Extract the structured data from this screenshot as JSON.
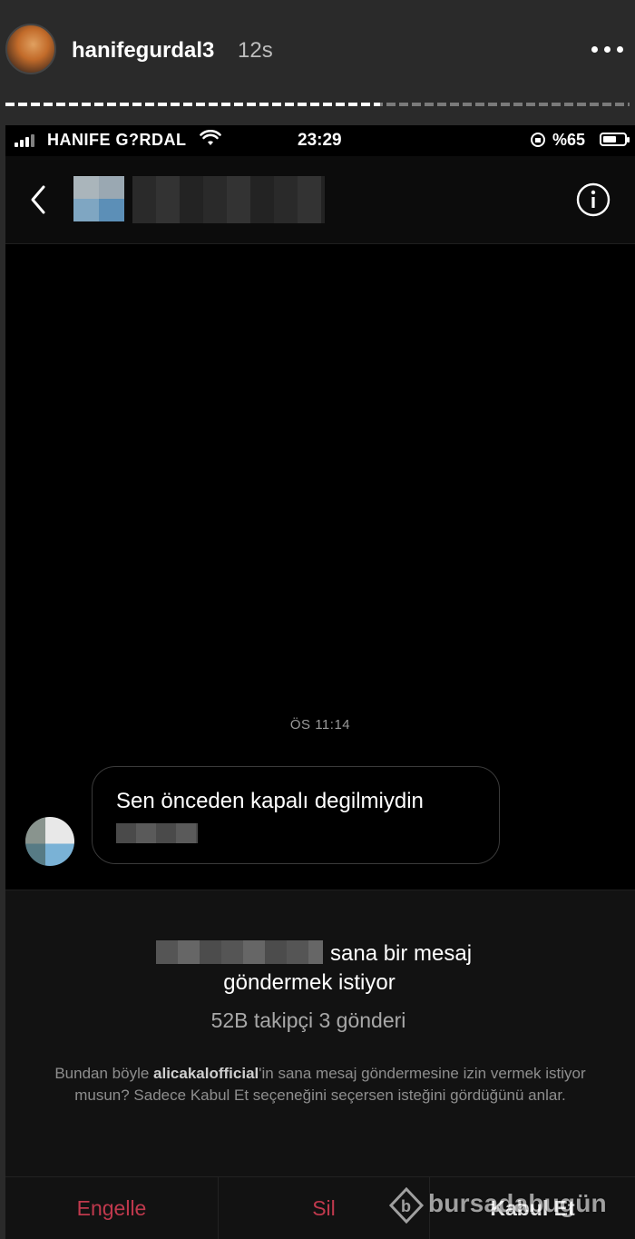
{
  "story": {
    "username": "hanifegurdal3",
    "time_ago": "12s",
    "progress_fraction": 0.6,
    "menu_icon": "more-horizontal-icon"
  },
  "status_bar": {
    "carrier": "HANIFE G?RDAL",
    "time": "23:29",
    "battery_text": "%65",
    "battery_fraction": 0.65
  },
  "conversation": {
    "timestamp": "ÖS 11:14",
    "message": "Sen önceden kapalı degilmiydin"
  },
  "request": {
    "line1_suffix": "sana bir mesaj",
    "line2": "göndermek istiyor",
    "stats": "52B takipçi 3 gönderi",
    "desc_before": "Bundan böyle ",
    "desc_user": "alicakalofficial",
    "desc_after": "'in sana mesaj göndermesine izin vermek istiyor musun? Sadece Kabul Et seçeneğini seçersen isteğini gördüğünü anlar."
  },
  "actions": {
    "block": "Engelle",
    "delete": "Sil",
    "accept": "Kabul Et"
  },
  "watermark": {
    "text": "bursadabugün"
  },
  "colors": {
    "danger": "#c0394d",
    "panel": "#121212",
    "background": "#000000"
  }
}
